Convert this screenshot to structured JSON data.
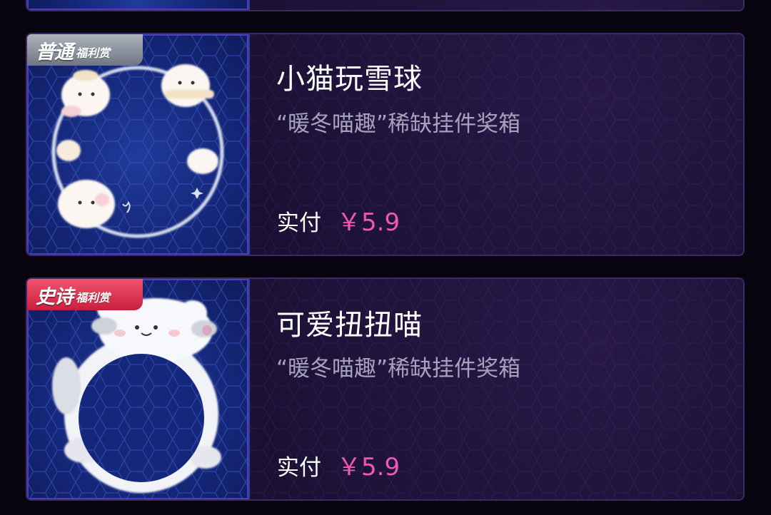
{
  "items": [
    {
      "badge": {
        "main": "普通",
        "sub": "福利赏",
        "color": "#8a919c"
      },
      "title": "小猫玩雪球",
      "subtitle": "“暖冬喵趣”稀缺挂件奖箱",
      "price_label": "实付",
      "price_value": "￥5.9",
      "art_icon": "cat-snowball-frame-icon"
    },
    {
      "badge": {
        "main": "史诗",
        "sub": "福利赏",
        "color": "#e23a57"
      },
      "title": "可爱扭扭喵",
      "subtitle": "“暖冬喵趣”稀缺挂件奖箱",
      "price_label": "实付",
      "price_value": "￥5.9",
      "art_icon": "wiggle-cat-frame-icon"
    }
  ],
  "colors": {
    "price": "#f057b7",
    "background": "#07040f",
    "card": "#1a1033"
  }
}
